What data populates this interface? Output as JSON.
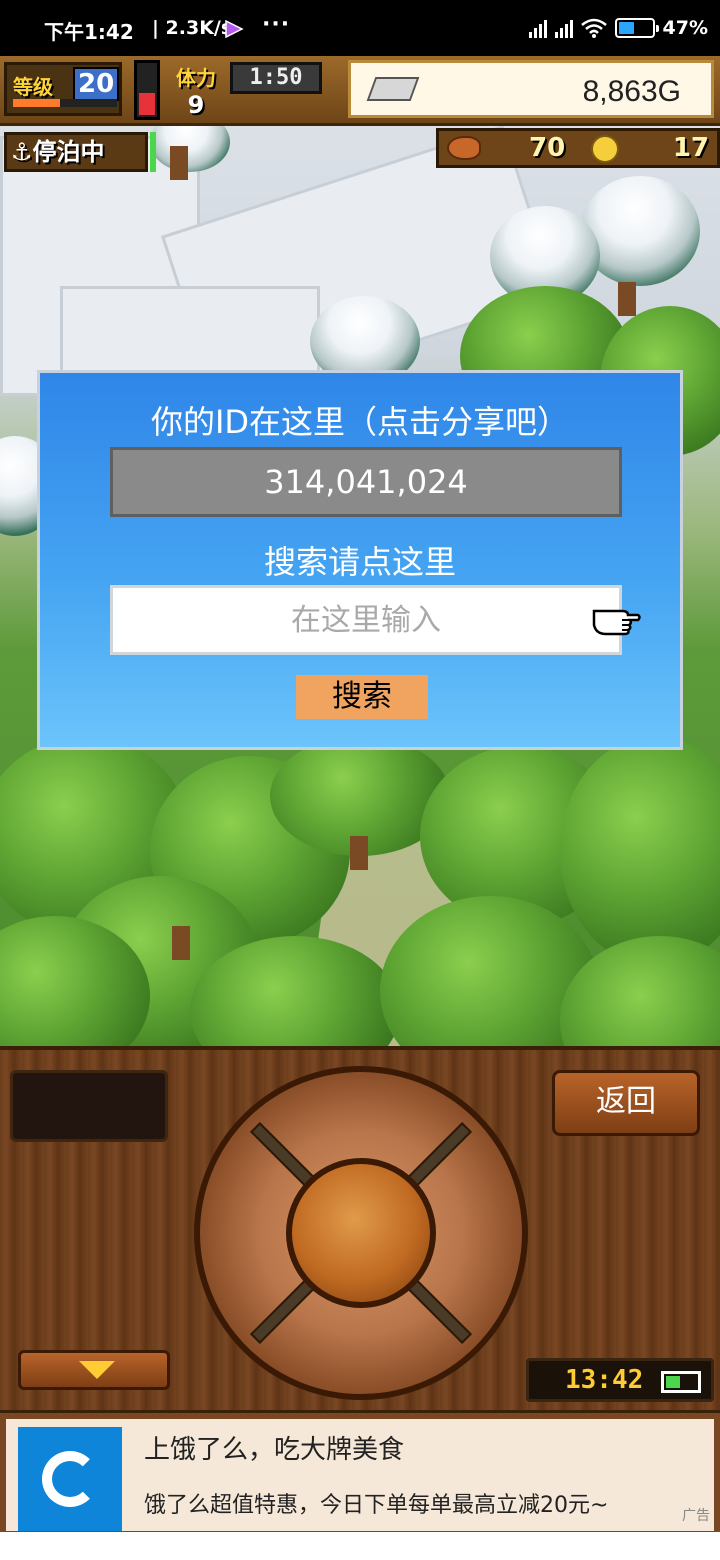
{
  "status_bar": {
    "time": "下午1:42",
    "network_speed": "| 2.3K/s",
    "dots": "···",
    "battery_percent": "47%",
    "battery_level": 0.47
  },
  "hud": {
    "level_label": "等级",
    "level_value": "20",
    "level_progress": 0.45,
    "stamina_label": "体力",
    "stamina_value": "9",
    "stamina_level": 0.4,
    "timer": "1:50",
    "gold": "8,863G",
    "docked_label": "⚓停泊中",
    "food_value": "70",
    "coin_value": "17"
  },
  "dialog": {
    "title": "你的ID在这里（点击分享吧）",
    "user_id": "314,041,024",
    "search_hint": "搜索请点这里",
    "search_placeholder": "在这里输入",
    "search_button": "搜索"
  },
  "panel": {
    "back_label": "返回",
    "clock": "13:42"
  },
  "ad": {
    "title": "上饿了么，吃大牌美食",
    "subtitle": "饿了么超值特惠，今日下单每单最高立减20元~",
    "tag": "广告",
    "brand_color": "#0e85d8"
  },
  "colors": {
    "dialog_top": "#2f86e8",
    "dialog_bottom": "#6cc4fb",
    "id_field": "#8a8a8a",
    "search_button": "#f1a460"
  }
}
